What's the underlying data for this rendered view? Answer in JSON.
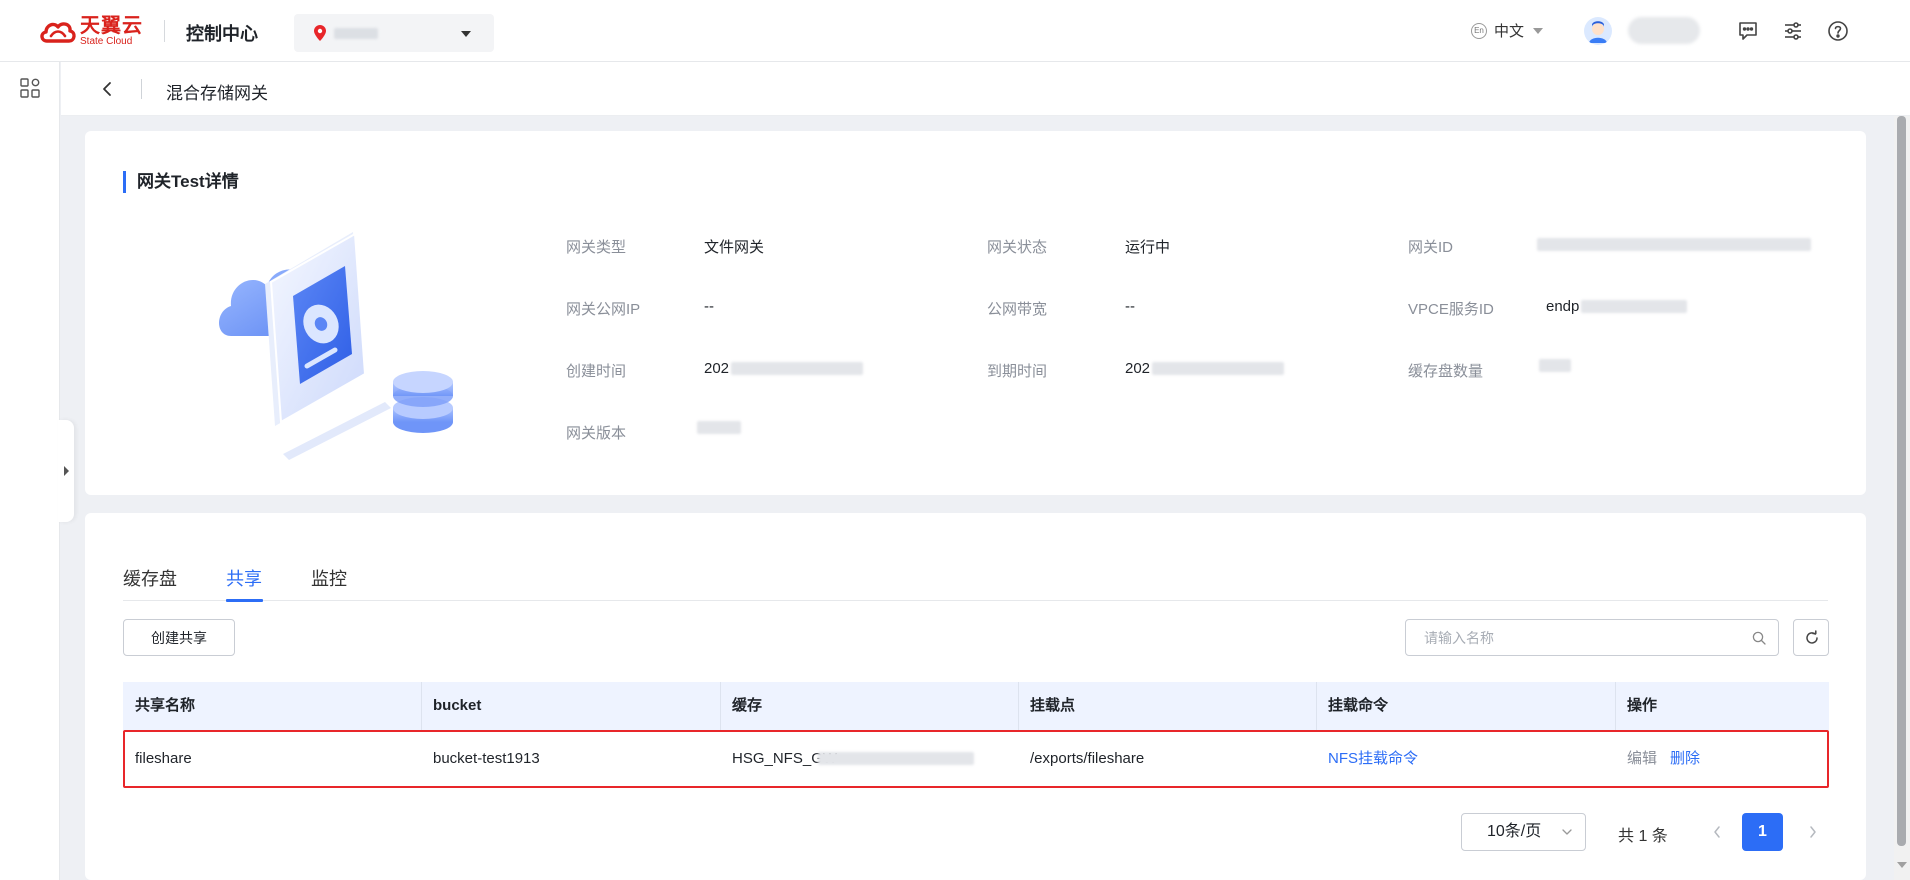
{
  "header": {
    "logo_cn": "天翼云",
    "logo_en": "State Cloud",
    "console_title": "控制中心",
    "language": "中文",
    "lang_badge": "En",
    "icons": [
      "location-pin-icon",
      "chevron-down-icon",
      "message-icon",
      "settings-sliders-icon",
      "help-icon"
    ]
  },
  "page": {
    "title": "混合存储网关"
  },
  "detail": {
    "section_title": "网关Test详情",
    "fields": [
      {
        "label": "网关类型",
        "value": "文件网关"
      },
      {
        "label": "网关状态",
        "value": "运行中"
      },
      {
        "label": "网关ID",
        "value": ""
      },
      {
        "label": "网关公网IP",
        "value": "--"
      },
      {
        "label": "公网带宽",
        "value": "--"
      },
      {
        "label": "VPCE服务ID",
        "value": "endp"
      },
      {
        "label": "创建时间",
        "value": "202"
      },
      {
        "label": "到期时间",
        "value": "202"
      },
      {
        "label": "缓存盘数量",
        "value": ""
      },
      {
        "label": "网关版本",
        "value": ""
      }
    ]
  },
  "share": {
    "tabs": [
      {
        "label": "缓存盘",
        "active": false
      },
      {
        "label": "共享",
        "active": true
      },
      {
        "label": "监控",
        "active": false
      }
    ],
    "create_button": "创建共享",
    "search_placeholder": "请输入名称",
    "columns": [
      "共享名称",
      "bucket",
      "缓存",
      "挂载点",
      "挂载命令",
      "操作"
    ],
    "rows": [
      {
        "name": "fileshare",
        "bucket": "bucket-test1913",
        "cache": "HSG_NFS_GW",
        "mount_point": "/exports/fileshare",
        "mount_command": "NFS挂载命令",
        "actions": [
          "编辑",
          "删除"
        ]
      }
    ],
    "pagination": {
      "page_size": "10条/页",
      "total": "共 1 条",
      "current_page": "1"
    }
  },
  "colors": {
    "brand_red": "#d9221c",
    "accent_blue": "#2c6df6",
    "highlight_red": "#e8262a"
  }
}
